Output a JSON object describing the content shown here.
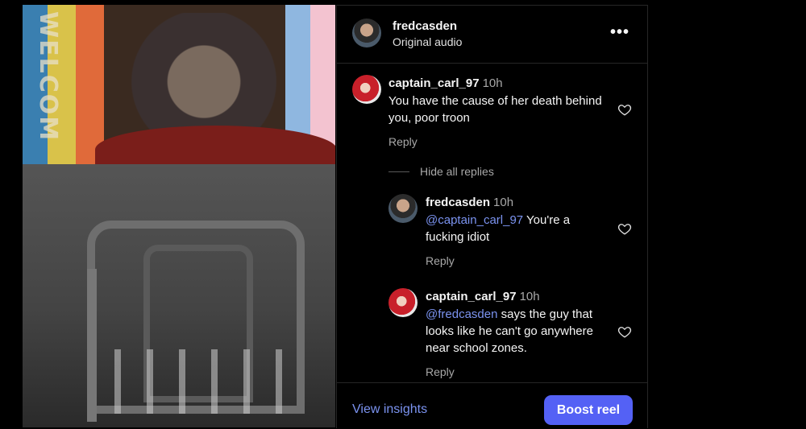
{
  "video": {
    "banner_text": "WELCOM"
  },
  "header": {
    "username": "fredcasden",
    "subtitle": "Original audio",
    "more_icon": "more-horizontal-icon"
  },
  "comments": [
    {
      "username": "captain_carl_97",
      "time": "10h",
      "text": "You have the cause of her death behind you, poor troon",
      "reply_label": "Reply"
    }
  ],
  "thread": {
    "hide_label": "Hide all replies",
    "replies": [
      {
        "username": "fredcasden",
        "time": "10h",
        "mention": "@captain_carl_97",
        "text": " You're a fucking idiot",
        "reply_label": "Reply"
      },
      {
        "username": "captain_carl_97",
        "time": "10h",
        "mention": "@fredcasden",
        "text": " says the guy that looks like he can't go anywhere near school zones.",
        "reply_label": "Reply"
      }
    ]
  },
  "footer": {
    "insights_label": "View insights",
    "boost_label": "Boost reel"
  },
  "colors": {
    "link": "#7b93f0",
    "button": "#5461f5",
    "muted": "#a8a8a8"
  }
}
